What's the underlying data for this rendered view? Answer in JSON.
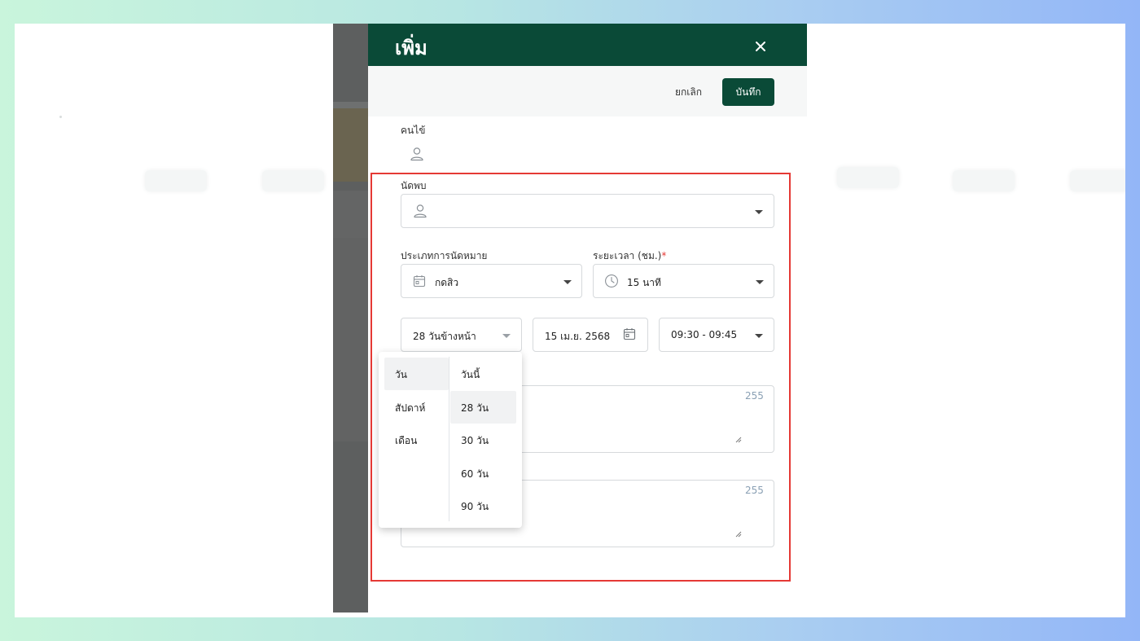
{
  "drawer": {
    "title": "เพิ่ม",
    "close_icon": "close-icon"
  },
  "actions": {
    "cancel_label": "ยกเลิก",
    "save_label": "บันทึก"
  },
  "form": {
    "patient_label": "คนไข้",
    "appointment_with_label": "นัดพบ",
    "appointment_with_value": "",
    "appointment_type_label": "ประเภทการนัดหมาย",
    "appointment_type_value": "กดสิว",
    "duration_label": "ระยะเวลา (ชม.)",
    "duration_required_mark": "*",
    "duration_value": "15 นาที",
    "relative_date_value": "28 วันข้างหน้า",
    "date_value": "15 เม.ย. 2568",
    "time_value": "09:30 - 09:45",
    "textarea1_counter": "255",
    "textarea2_counter": "255"
  },
  "popup": {
    "units": [
      "วัน",
      "สัปดาห์",
      "เดือน"
    ],
    "selected_unit": "วัน",
    "options": [
      "วันนี้",
      "28 วัน",
      "30 วัน",
      "60 วัน",
      "90 วัน"
    ],
    "selected_option": "28 วัน"
  },
  "colors": {
    "header_green": "#0a4a37",
    "highlight_red": "#e53935",
    "counter_blue": "#8aa0b4"
  }
}
